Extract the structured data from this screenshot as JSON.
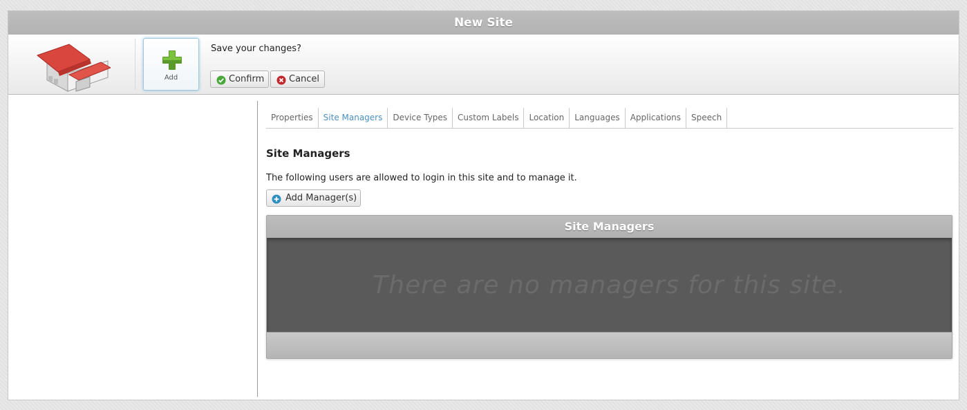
{
  "window": {
    "title": "New Site"
  },
  "toolbar": {
    "add_label": "Add",
    "prompt": "Save your changes?",
    "confirm_label": "Confirm",
    "cancel_label": "Cancel"
  },
  "tabs": [
    {
      "label": "Properties",
      "active": false
    },
    {
      "label": "Site Managers",
      "active": true
    },
    {
      "label": "Device Types",
      "active": false
    },
    {
      "label": "Custom Labels",
      "active": false
    },
    {
      "label": "Location",
      "active": false
    },
    {
      "label": "Languages",
      "active": false
    },
    {
      "label": "Applications",
      "active": false
    },
    {
      "label": "Speech",
      "active": false
    }
  ],
  "section": {
    "title": "Site Managers",
    "description": "The following users are allowed to login in this site and to manage it.",
    "add_button_label": "Add Manager(s)"
  },
  "grid": {
    "title": "Site Managers",
    "empty_message": "There are no managers for this site."
  },
  "colors": {
    "active_tab": "#4a90c2",
    "confirm_icon": "#4aa83a",
    "cancel_icon": "#c0282d",
    "add_icon": "#5a9a2a",
    "add_manager_icon": "#2f8fc0"
  },
  "icons": {
    "logo": "building-icon",
    "add": "plus-icon",
    "confirm": "check-circle-icon",
    "cancel": "x-circle-icon",
    "add_manager": "plus-circle-icon"
  }
}
